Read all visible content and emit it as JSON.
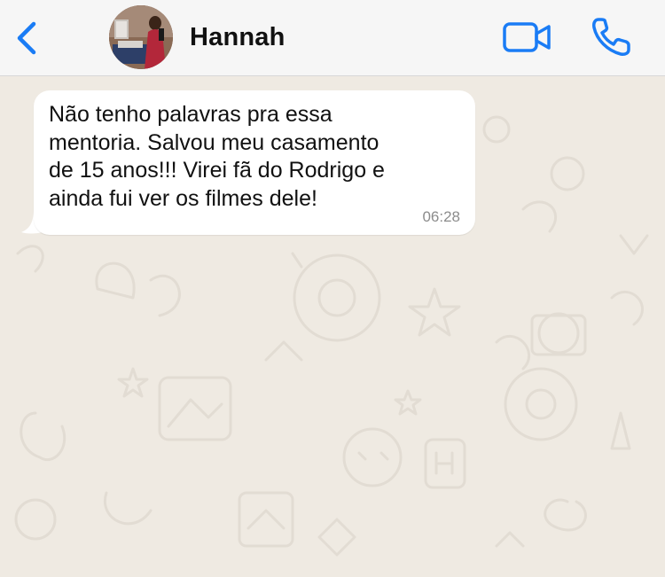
{
  "header": {
    "back_icon": "chevron-left-icon",
    "contact_name": "Hannah",
    "video_icon": "video-camera-icon",
    "call_icon": "phone-icon",
    "accent_color": "#1a7cf5"
  },
  "chat": {
    "background_color": "#efeae2",
    "messages": [
      {
        "direction": "incoming",
        "text": "Não tenho palavras pra essa\nmentoria. Salvou meu casamento\nde 15 anos!!! Virei fã do Rodrigo e\nainda fui ver os filmes dele!",
        "time": "06:28"
      }
    ]
  }
}
